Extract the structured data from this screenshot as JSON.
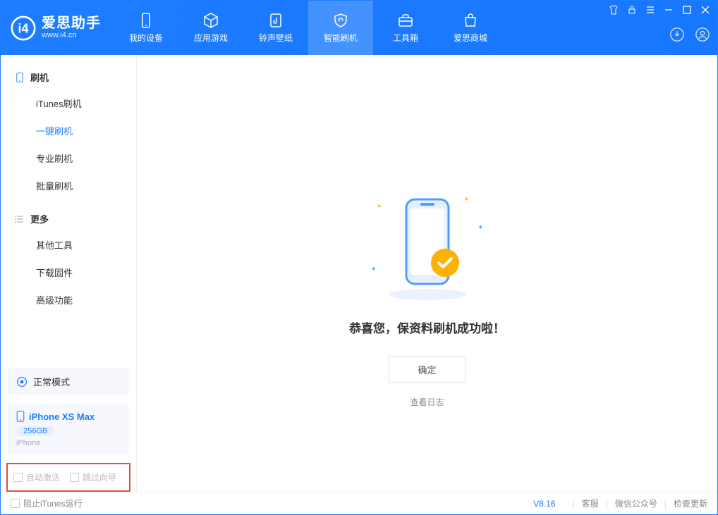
{
  "app": {
    "name_cn": "爱思助手",
    "name_en": "www.i4.cn"
  },
  "nav": {
    "items": [
      {
        "label": "我的设备"
      },
      {
        "label": "应用游戏"
      },
      {
        "label": "铃声壁纸"
      },
      {
        "label": "智能刷机"
      },
      {
        "label": "工具箱"
      },
      {
        "label": "爱思商城"
      }
    ]
  },
  "sidebar": {
    "section1": {
      "title": "刷机",
      "items": [
        {
          "label": "iTunes刷机"
        },
        {
          "label": "一键刷机"
        },
        {
          "label": "专业刷机"
        },
        {
          "label": "批量刷机"
        }
      ]
    },
    "section2": {
      "title": "更多",
      "items": [
        {
          "label": "其他工具"
        },
        {
          "label": "下载固件"
        },
        {
          "label": "高级功能"
        }
      ]
    },
    "mode_label": "正常模式",
    "device": {
      "name": "iPhone XS Max",
      "storage": "256GB",
      "type": "iPhone"
    },
    "checks": {
      "auto_activate": "自动激活",
      "skip_guide": "跳过向导"
    }
  },
  "main": {
    "success_msg": "恭喜您，保资料刷机成功啦！",
    "ok_label": "确定",
    "log_link": "查看日志"
  },
  "footer": {
    "block_itunes": "阻止iTunes运行",
    "version": "V8.16",
    "links": [
      "客服",
      "微信公众号",
      "检查更新"
    ]
  }
}
